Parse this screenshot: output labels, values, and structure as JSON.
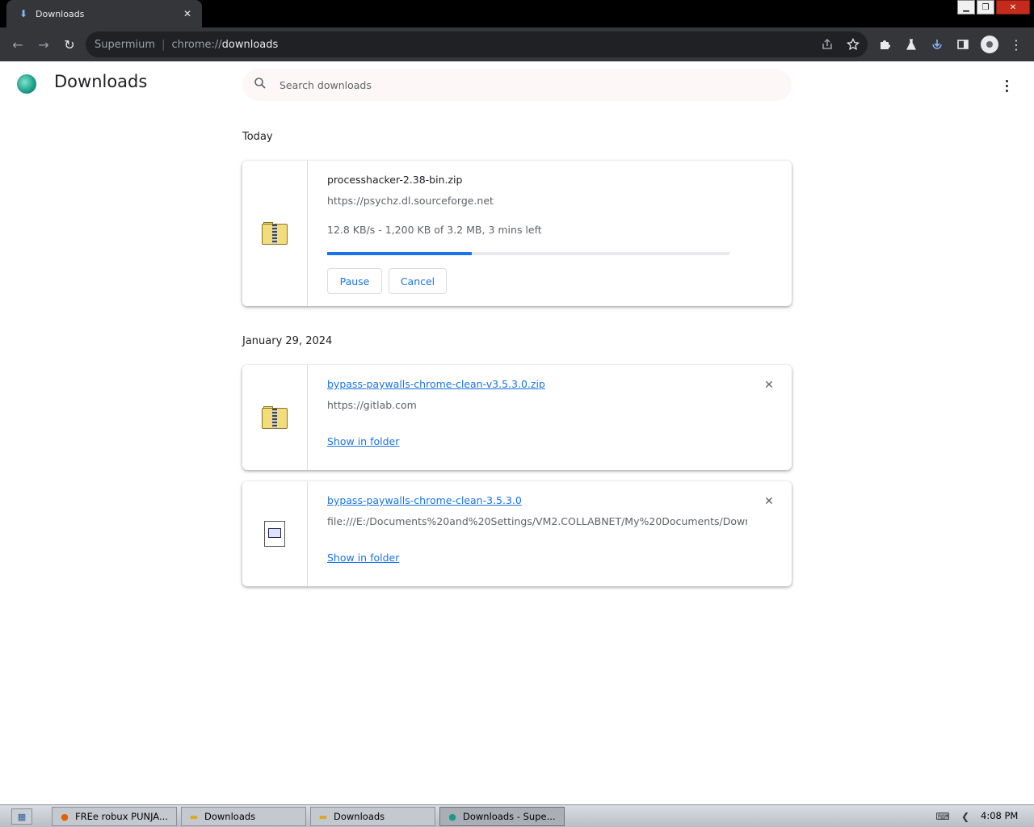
{
  "browser": {
    "tab_title": "Downloads",
    "omnibox": {
      "site_label": "Supermium",
      "separator": "|",
      "url_scheme": "chrome://",
      "url_path": "downloads"
    }
  },
  "page": {
    "title": "Downloads",
    "search": {
      "placeholder": "Search downloads",
      "value": ""
    }
  },
  "sections": [
    {
      "label": "Today",
      "items": [
        {
          "filename": "processhacker-2.38-bin.zip",
          "source": "https://psychz.dl.sourceforge.net",
          "status": "12.8 KB/s - 1,200 KB of 3.2 MB, 3 mins left",
          "progress": 0.36,
          "pause_label": "Pause",
          "cancel_label": "Cancel",
          "icon": "zip-folder-icon"
        }
      ]
    },
    {
      "label": "January 29, 2024",
      "items": [
        {
          "filename": "bypass-paywalls-chrome-clean-v3.5.3.0.zip",
          "source": "https://gitlab.com",
          "show_in_folder_label": "Show in folder",
          "icon": "zip-folder-icon"
        },
        {
          "filename": "bypass-paywalls-chrome-clean-3.5.3.0",
          "source": "file:///E:/Documents%20and%20Settings/VM2.COLLABNET/My%20Documents/Down...",
          "show_in_folder_label": "Show in folder",
          "icon": "application-file-icon"
        }
      ]
    }
  ],
  "taskbar": {
    "tasks": [
      {
        "label": "FREe robux PUNJA...",
        "icon": "firefox-icon"
      },
      {
        "label": "Downloads",
        "icon": "folder-icon"
      },
      {
        "label": "Downloads",
        "icon": "folder-icon"
      },
      {
        "label": "Downloads - Supe...",
        "icon": "supermium-icon"
      }
    ],
    "clock": "4:08 PM"
  },
  "colors": {
    "accent": "#1a73e8",
    "toolbar": "#35363a",
    "omnibox": "#202124"
  }
}
